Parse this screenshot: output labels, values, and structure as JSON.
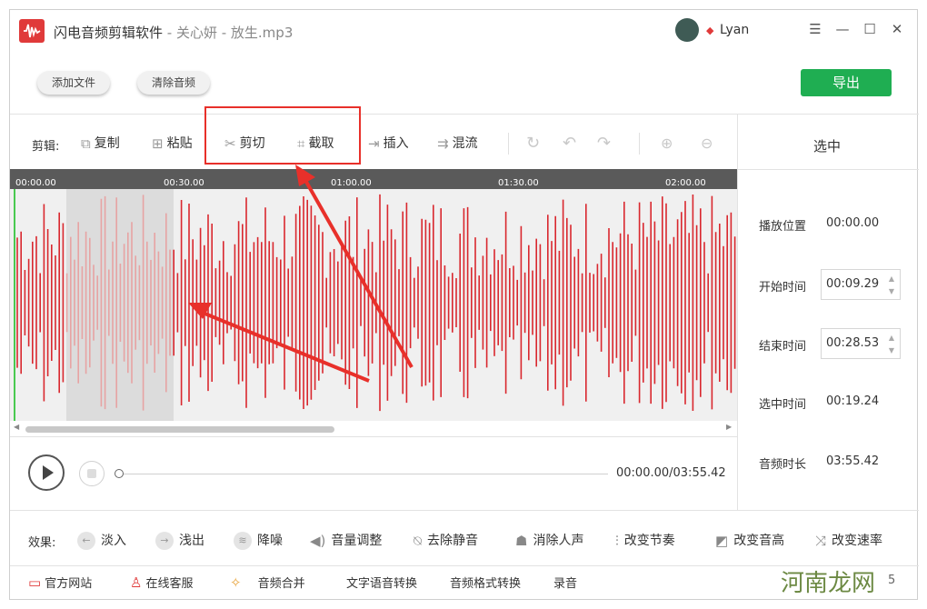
{
  "titlebar": {
    "app_name": "闪电音频剪辑软件",
    "file_sub": " - 关心妍 - 放生.mp3",
    "username": "Lyan"
  },
  "toolbar": {
    "add_file": "添加文件",
    "clear_audio": "清除音频",
    "export": "导出"
  },
  "edit": {
    "label": "剪辑:",
    "copy": "复制",
    "paste": "粘贴",
    "cut": "剪切",
    "crop": "截取",
    "insert": "插入",
    "mix": "混流"
  },
  "ruler": [
    "00:00.00",
    "00:30.00",
    "01:00.00",
    "01:30.00",
    "02:00.00"
  ],
  "player": {
    "time": "00:00.00/03:55.42"
  },
  "selection_panel": {
    "title": "选中",
    "play_position_label": "播放位置",
    "play_position": "00:00.00",
    "start_label": "开始时间",
    "start": "00:09.29",
    "end_label": "结束时间",
    "end": "00:28.53",
    "selected_label": "选中时间",
    "selected": "00:19.24",
    "duration_label": "音频时长",
    "duration": "03:55.42"
  },
  "effects": {
    "label": "效果:",
    "items": [
      "淡入",
      "浅出",
      "降噪",
      "音量调整",
      "去除静音",
      "消除人声",
      "改变节奏",
      "改变音高",
      "改变速率"
    ]
  },
  "footer": {
    "website": "官方网站",
    "support": "在线客服",
    "merge": "音频合并",
    "tts": "文字语音转换",
    "convert": "音频格式转换",
    "record": "录音",
    "page_num": "5"
  },
  "watermark": "河南龙网",
  "colors": {
    "accent": "#e03a3a",
    "export": "#1fae52",
    "wave": "#d9272e"
  }
}
